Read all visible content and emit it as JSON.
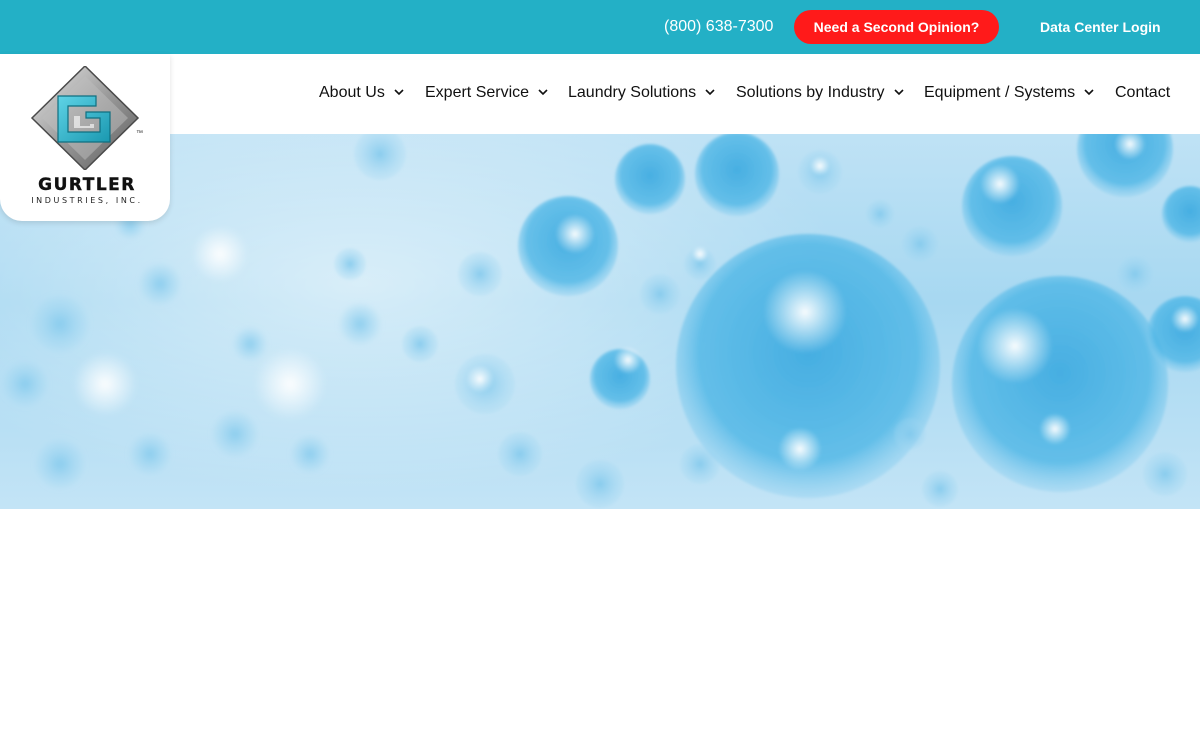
{
  "topbar": {
    "phone": "(800) 638-7300",
    "cta_label": "Need a Second Opinion?",
    "login_label": "Data Center Login"
  },
  "logo": {
    "wordmark": "GURTLER",
    "subtext": "INDUSTRIES, INC.",
    "trademark": "™"
  },
  "nav": {
    "items": [
      {
        "label": "About Us",
        "has_dropdown": true
      },
      {
        "label": "Expert Service",
        "has_dropdown": true
      },
      {
        "label": "Laundry Solutions",
        "has_dropdown": true
      },
      {
        "label": "Solutions by Industry",
        "has_dropdown": true
      },
      {
        "label": "Equipment / Systems",
        "has_dropdown": true
      },
      {
        "label": "Contact",
        "has_dropdown": false
      }
    ]
  },
  "colors": {
    "topbar_bg": "#23b0c6",
    "cta_bg": "#ff1a1a",
    "logo_teal": "#2bb3c9",
    "hero_bubble": "#4db6e6"
  },
  "icons": {
    "dropdown": "chevron-down-icon",
    "logo": "gurtler-logo-icon"
  }
}
